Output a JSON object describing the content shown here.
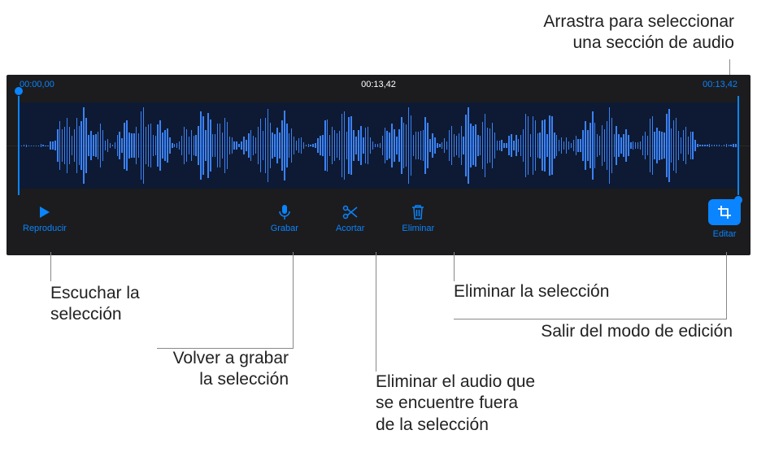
{
  "callouts": {
    "drag_select": "Arrastra para seleccionar\nuna sección de audio",
    "listen_selection": "Escuchar la\nselección",
    "rerecord_selection": "Volver a grabar\nla selección",
    "trim_outside": "Eliminar el audio que\nse encuentre fuera\nde la selección",
    "delete_selection": "Eliminar la selección",
    "exit_edit": "Salir del modo de edición"
  },
  "editor": {
    "time_start": "00:00,00",
    "time_current": "00:13,42",
    "time_end": "00:13,42"
  },
  "toolbar": {
    "play": "Reproducir",
    "record": "Grabar",
    "trim": "Acortar",
    "delete": "Eliminar",
    "edit": "Editar"
  },
  "colors": {
    "accent": "#0a84ff",
    "panel_bg": "#1c1c1e",
    "selection_bg": "#0e1a33"
  }
}
